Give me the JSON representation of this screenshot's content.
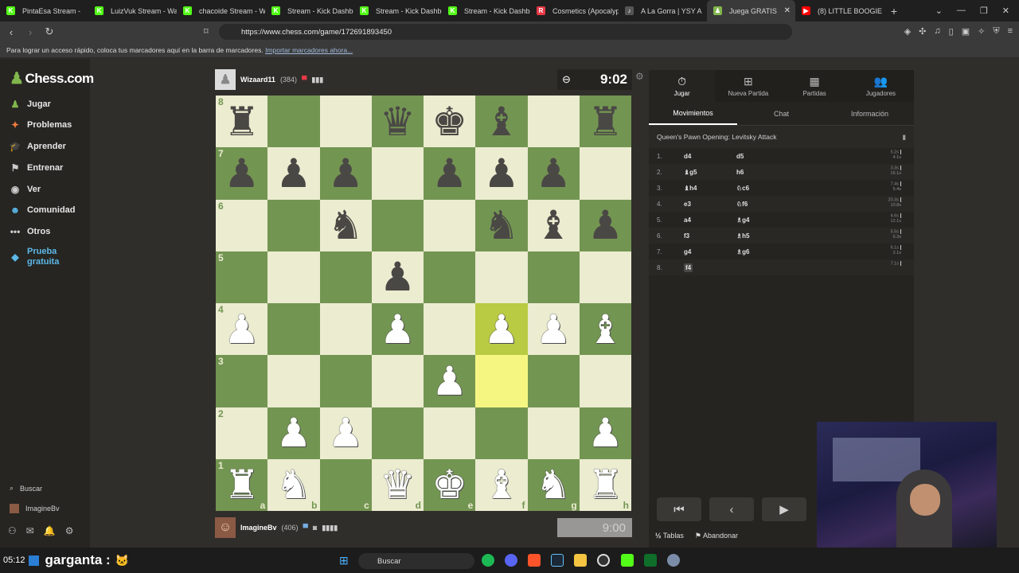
{
  "browser": {
    "tabs": [
      {
        "title": "PintaEsa Stream -",
        "fav_color": "#53fc18",
        "fav_char": "K"
      },
      {
        "title": "LuizVuk Stream - Wat",
        "fav_color": "#53fc18",
        "fav_char": "K"
      },
      {
        "title": "chacoide Stream - W",
        "fav_color": "#53fc18",
        "fav_char": "K"
      },
      {
        "title": "Stream - Kick Dashbo",
        "fav_color": "#53fc18",
        "fav_char": "K"
      },
      {
        "title": "Stream - Kick Dashbo",
        "fav_color": "#53fc18",
        "fav_char": "K"
      },
      {
        "title": "Stream - Kick Dashbo",
        "fav_color": "#53fc18",
        "fav_char": "K"
      },
      {
        "title": "Cosmetics (Apocalyp",
        "fav_color": "#e63946",
        "fav_char": "R"
      },
      {
        "title": "A La Gorra | YSY A",
        "fav_color": "#555555",
        "fav_char": "♪"
      },
      {
        "title": "Juega GRATIS",
        "fav_color": "#81b64c",
        "fav_char": "♟",
        "active": true
      },
      {
        "title": "(8) LITTLE BOOGIE",
        "fav_color": "#ff0000",
        "fav_char": "▶"
      }
    ],
    "tab_close": "✕",
    "new_tab": "+",
    "url": "https://www.chess.com/game/172691893450",
    "bookmarks_text": "Para lograr un acceso rápido, coloca tus marcadores aquí en la barra de marcadores.",
    "bookmarks_link": "Importar marcadores ahora..."
  },
  "sidebar": {
    "logo": "Chess.com",
    "items": [
      {
        "label": "Jugar",
        "icon": "♟",
        "color": "#81b64c"
      },
      {
        "label": "Problemas",
        "icon": "✦",
        "color": "#f07b3f"
      },
      {
        "label": "Aprender",
        "icon": "🎓",
        "color": "#5cb8e6"
      },
      {
        "label": "Entrenar",
        "icon": "⚑",
        "color": "#cccccc"
      },
      {
        "label": "Ver",
        "icon": "◉",
        "color": "#cccccc"
      },
      {
        "label": "Comunidad",
        "icon": "☻",
        "color": "#5cb8e6"
      },
      {
        "label": "Otros",
        "icon": "•••",
        "color": "#cccccc"
      }
    ],
    "trial_label_1": "Prueba",
    "trial_label_2": "gratuita",
    "search_label": "Buscar",
    "user_label": "ImagineBv"
  },
  "game": {
    "top_player": {
      "name": "Wizaard11",
      "rating": "(384)"
    },
    "bottom_player": {
      "name": "ImagineBv",
      "rating": "(406)"
    },
    "top_clock": "9:02",
    "bottom_clock": "9:00",
    "board": [
      [
        "bR",
        "",
        "",
        "bQ",
        "bK",
        "bB",
        "",
        "bR"
      ],
      [
        "bP",
        "bP",
        "bP",
        "",
        "bP",
        "bP",
        "bP",
        ""
      ],
      [
        "",
        "",
        "bN",
        "",
        "",
        "bN",
        "bB",
        "bP"
      ],
      [
        "",
        "",
        "",
        "bP",
        "",
        "",
        "",
        ""
      ],
      [
        "wP",
        "",
        "",
        "wP",
        "",
        "wP",
        "wP",
        "wB"
      ],
      [
        "",
        "",
        "",
        "",
        "wP",
        "",
        "",
        ""
      ],
      [
        "",
        "wP",
        "wP",
        "",
        "",
        "",
        "",
        "wP"
      ],
      [
        "wR",
        "wN",
        "",
        "wQ",
        "wK",
        "wB",
        "wN",
        "wR"
      ]
    ],
    "highlight": [
      "f4",
      "f3"
    ],
    "ranks": [
      "8",
      "7",
      "6",
      "5",
      "4",
      "3",
      "2",
      "1"
    ],
    "files": [
      "a",
      "b",
      "c",
      "d",
      "e",
      "f",
      "g",
      "h"
    ]
  },
  "panel": {
    "tabs": [
      {
        "label": "Jugar",
        "icon": "⏱",
        "active": true
      },
      {
        "label": "Nueva Partida",
        "icon": "⊞"
      },
      {
        "label": "Partidas",
        "icon": "▦"
      },
      {
        "label": "Jugadores",
        "icon": "👥"
      }
    ],
    "subtabs": [
      {
        "label": "Movimientos",
        "active": true
      },
      {
        "label": "Chat"
      },
      {
        "label": "Información"
      }
    ],
    "opening": "Queen's Pawn Opening: Levitsky Attack",
    "moves": [
      {
        "num": "1.",
        "white": "d4",
        "black": "d5",
        "t1": "5.2s",
        "t2": "4.1s"
      },
      {
        "num": "2.",
        "white": "♝g5",
        "black": "h6",
        "t1": "3.3s",
        "t2": "16.1s"
      },
      {
        "num": "3.",
        "white": "♝h4",
        "black": "♘c6",
        "t1": "7.4s",
        "t2": "5.4s"
      },
      {
        "num": "4.",
        "white": "e3",
        "black": "♘f6",
        "t1": "20.3s",
        "t2": "10.8s"
      },
      {
        "num": "5.",
        "white": "a4",
        "black": "♗g4",
        "t1": "4.6s",
        "t2": "12.1s"
      },
      {
        "num": "6.",
        "white": "f3",
        "black": "♗h5",
        "t1": "5.5s",
        "t2": "6.3s"
      },
      {
        "num": "7.",
        "white": "g4",
        "black": "♗g6",
        "t1": "6.1s",
        "t2": "2.1s"
      },
      {
        "num": "8.",
        "white": "f4",
        "black": "",
        "t1": "7.1s",
        "t2": ""
      }
    ],
    "draw_label": "Tablas",
    "resign_label": "Abandonar"
  },
  "taskbar": {
    "time": "05:12",
    "overlay_text": "garganta :",
    "search_label": "Buscar"
  }
}
